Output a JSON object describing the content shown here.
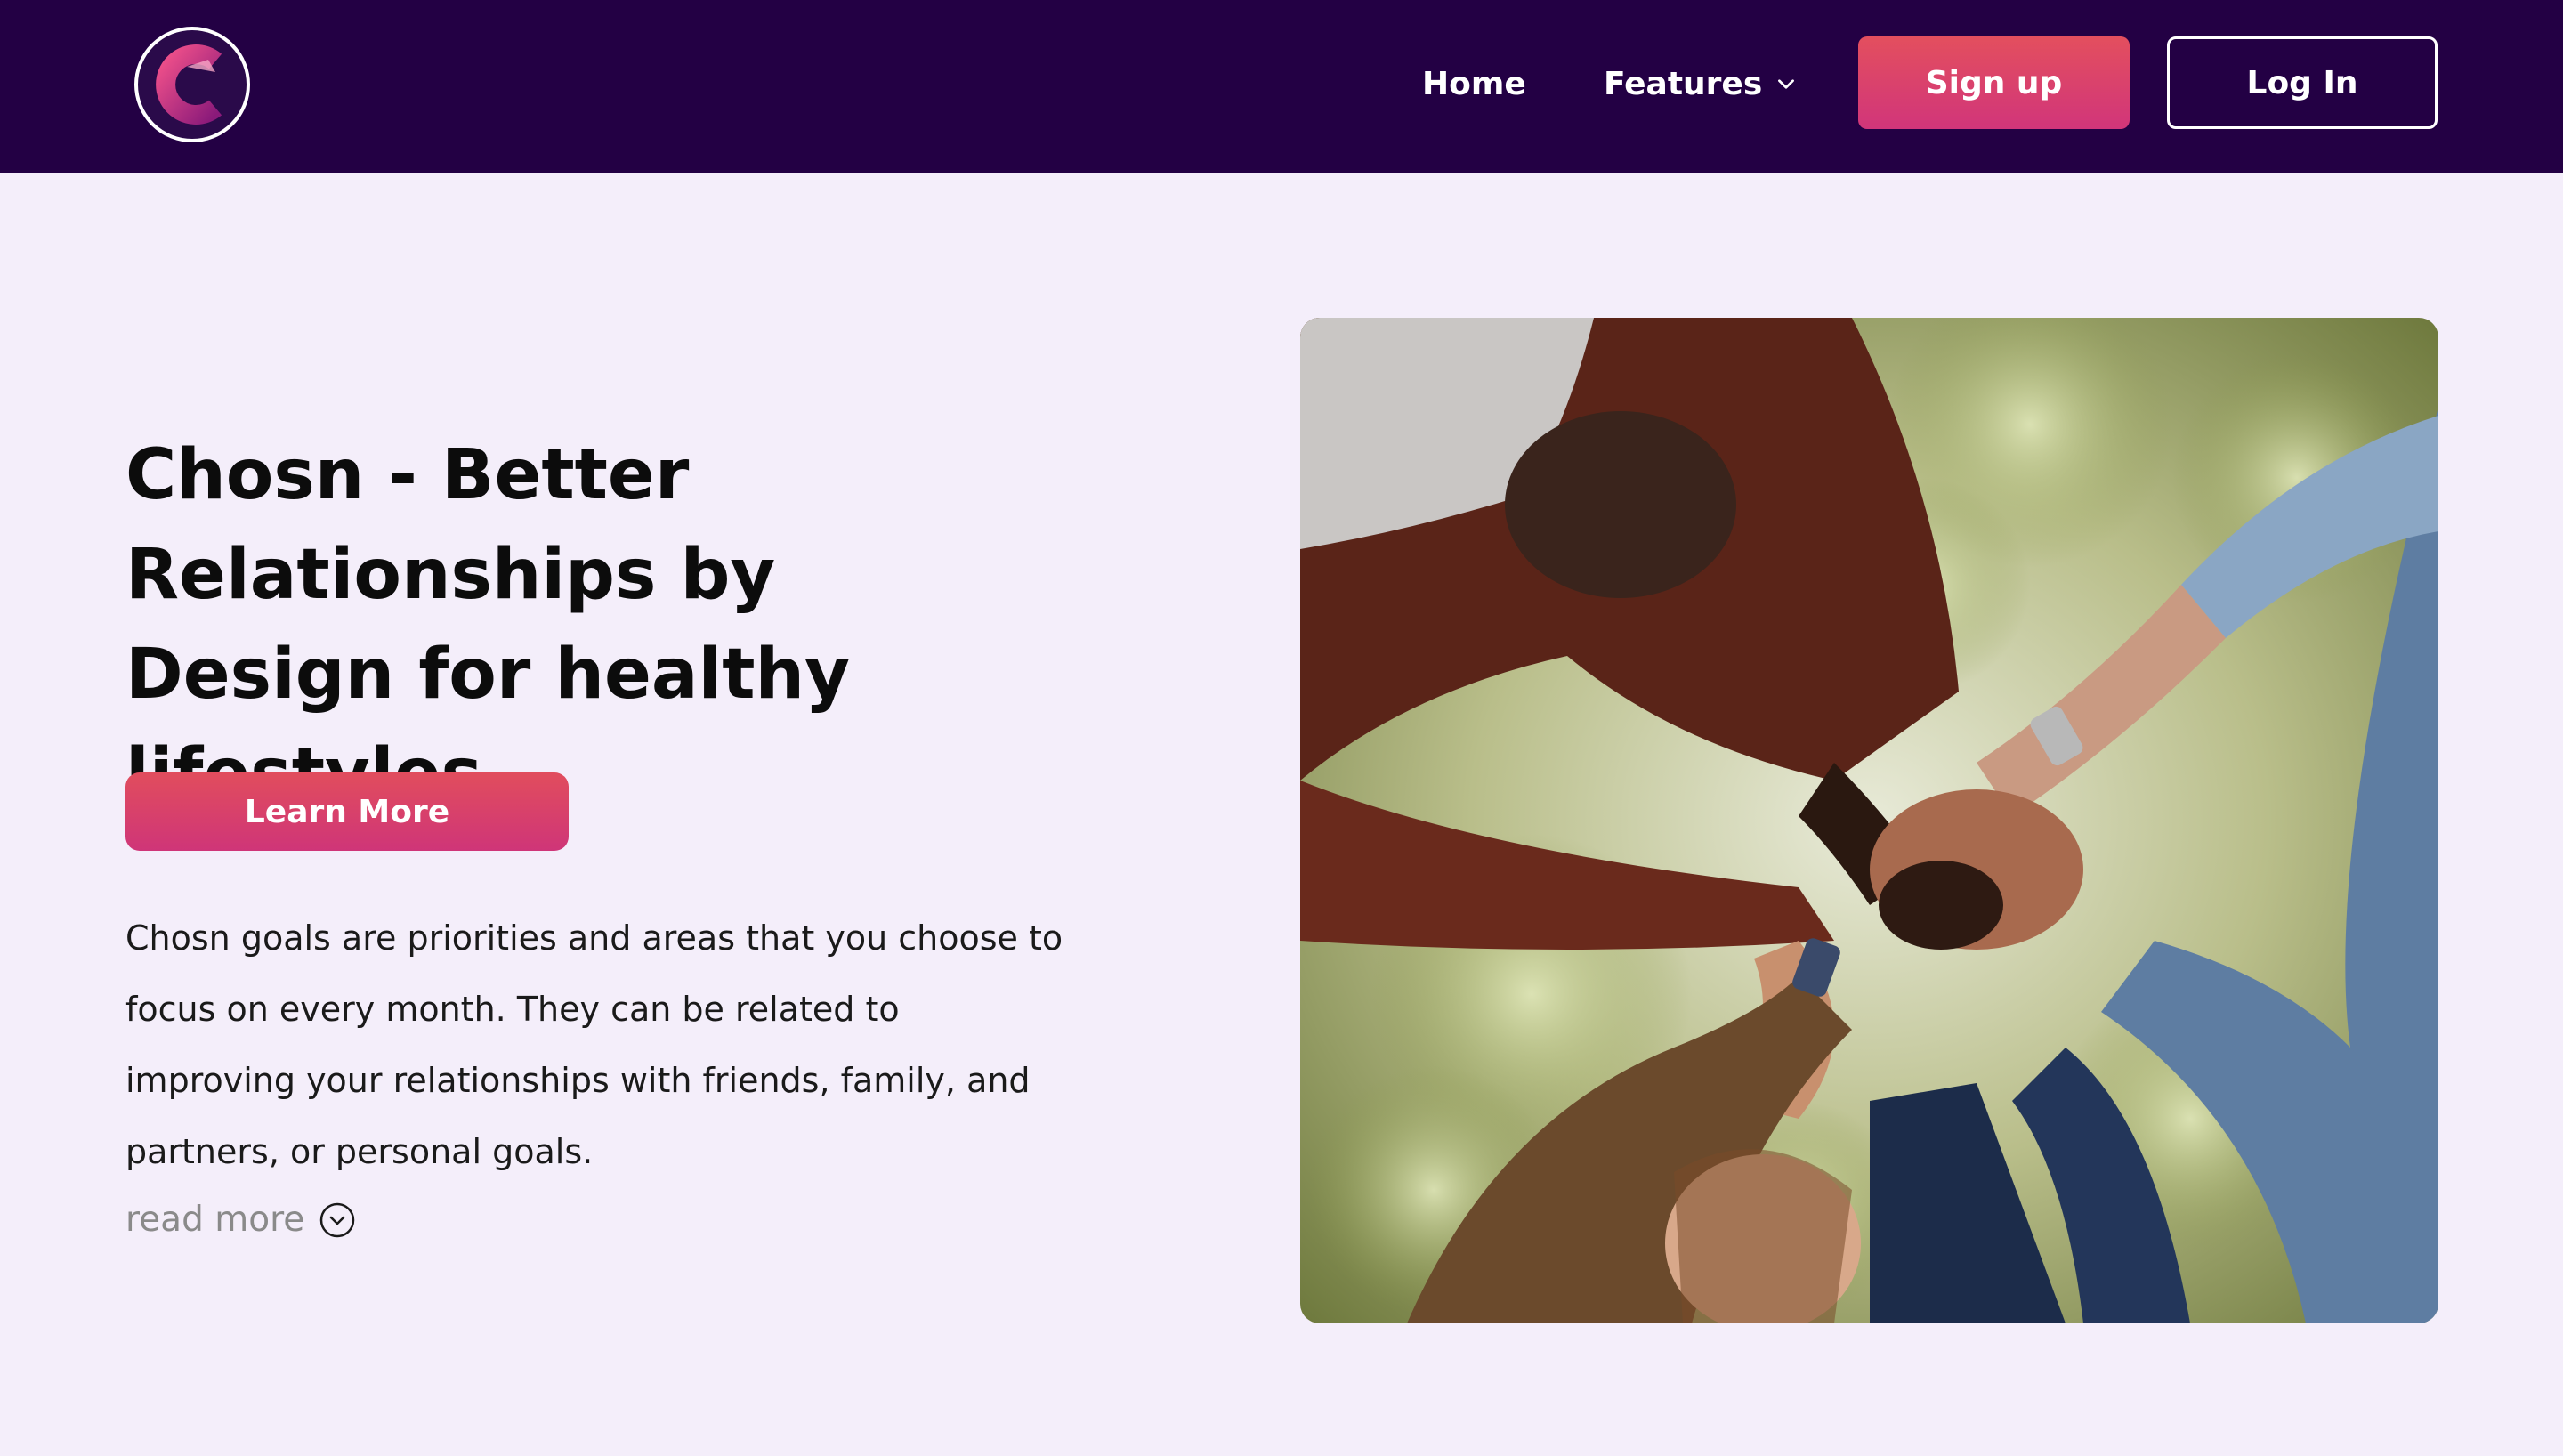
{
  "brand": {
    "logo_letter": "C",
    "accent_color": "#d1357a",
    "nav_bg_color": "#230044"
  },
  "nav": {
    "home_label": "Home",
    "features_label": "Features",
    "signup_label": "Sign up",
    "login_label": "Log In"
  },
  "hero": {
    "title": "Chosn - Better Relationships by Design for healthy lifestyles",
    "cta_label": "Learn More",
    "description": "Chosn goals are priorities and areas that you choose to focus on every month. They can be related to improving your relationships with friends, family, and partners, or personal goals.",
    "read_more_label": "read more"
  },
  "icons": {
    "features_dropdown": "chevron-down-icon",
    "read_more": "chevron-down-circle-icon"
  }
}
